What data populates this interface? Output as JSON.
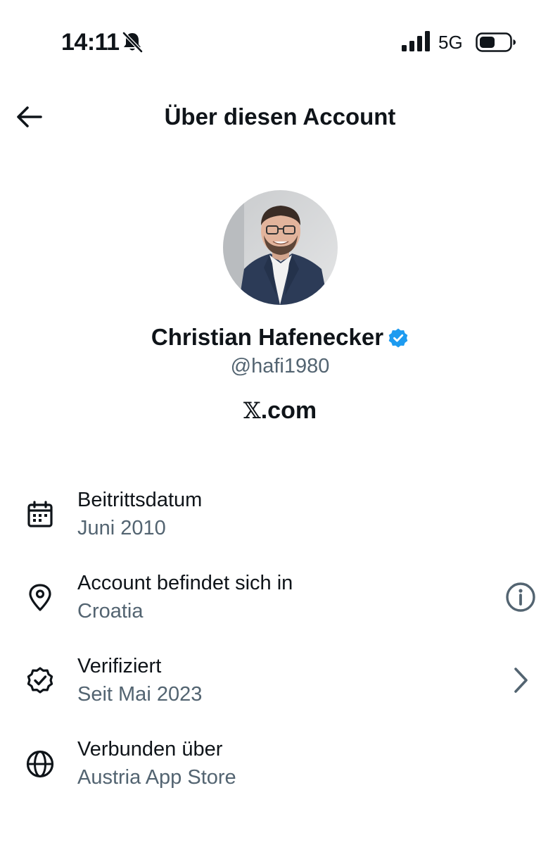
{
  "status_bar": {
    "time": "14:11",
    "network": "5G"
  },
  "header": {
    "title": "Über diesen Account"
  },
  "profile": {
    "name": "Christian Hafenecker",
    "handle": "@hafi1980",
    "site_symbol": "𝕏",
    "site_suffix": ".com",
    "verified_color": "#1d9bf0"
  },
  "info": [
    {
      "label": "Beitrittsdatum",
      "value": "Juni 2010",
      "icon": "calendar-icon"
    },
    {
      "label": "Account befindet sich in",
      "value": "Croatia",
      "icon": "location-pin-icon",
      "action_icon": "info-icon"
    },
    {
      "label": "Verifiziert",
      "value": "Seit Mai 2023",
      "icon": "verified-check-icon",
      "action_icon": "chevron-right-icon"
    },
    {
      "label": "Verbunden über",
      "value": "Austria App Store",
      "icon": "globe-icon"
    }
  ],
  "colors": {
    "text_primary": "#0f1419",
    "text_secondary": "#536471",
    "accent": "#1d9bf0"
  }
}
